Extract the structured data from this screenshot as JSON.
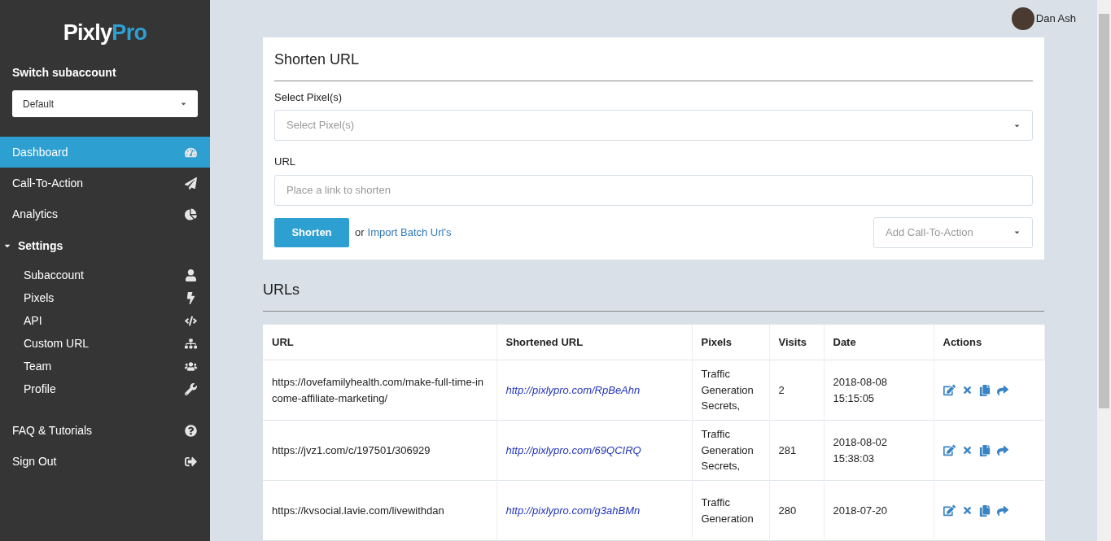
{
  "logo": {
    "part_1": "Pixly",
    "part_2": "Pro"
  },
  "subaccount": {
    "label": "Switch subaccount",
    "value": "Default"
  },
  "nav": [
    {
      "label": "Dashboard",
      "selected": true
    },
    {
      "label": "Call-To-Action",
      "selected": false
    },
    {
      "label": "Analytics",
      "selected": false
    },
    {
      "label": "Settings",
      "selected": false,
      "expanded": true,
      "children": [
        {
          "label": "Subaccount",
          "selected": false
        },
        {
          "label": "Pixels",
          "selected": false
        },
        {
          "label": "API",
          "selected": false
        },
        {
          "label": "Custom URL",
          "selected": false
        },
        {
          "label": "Team",
          "selected": false
        },
        {
          "label": "Profile",
          "selected": false
        }
      ]
    },
    {
      "label": "FAQ & Tutorials",
      "selected": false
    },
    {
      "label": "Sign Out",
      "selected": false
    }
  ],
  "user": {
    "name": "Dan Ash"
  },
  "shorten_form": {
    "title": "Shorten URL",
    "pixels_label": "Select Pixel(s)",
    "pixels_placeholder": "Select Pixel(s)",
    "url_label": "URL",
    "url_placeholder": "Place a link to shorten",
    "button": "Shorten",
    "or_text": "or",
    "import_link": "Import Batch Url's",
    "cta_placeholder": "Add Call-To-Action"
  },
  "urls": {
    "title": "URLs",
    "columns": [
      "URL",
      "Shortened URL",
      "Pixels",
      "Visits",
      "Date",
      "Actions"
    ],
    "rows": [
      {
        "url": "https://lovefamilyhealth.com/make-full-time-income-affiliate-marketing/",
        "short": "http://pixlypro.com/RpBeAhn",
        "pixels": "Traffic Generation Secrets,",
        "visits": "2",
        "date": "2018-08-08 15:15:05"
      },
      {
        "url": "https://jvz1.com/c/197501/306929",
        "short": "http://pixlypro.com/69QCIRQ",
        "pixels": "Traffic Generation Secrets,",
        "visits": "281",
        "date": "2018-08-02 15:38:03"
      },
      {
        "url": "https://kvsocial.lavie.com/livewithdan",
        "short": "http://pixlypro.com/g3ahBMn",
        "pixels": "Traffic Generation",
        "visits": "280",
        "date": "2018-07-20"
      }
    ]
  }
}
